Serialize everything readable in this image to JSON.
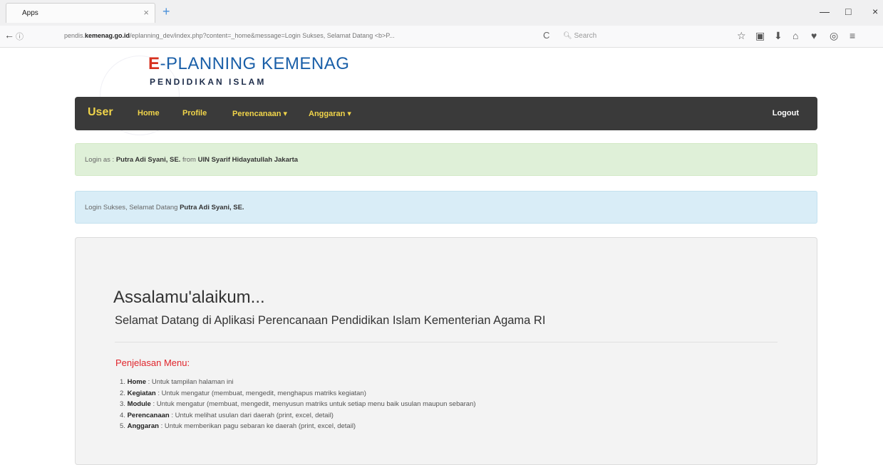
{
  "browser": {
    "tab_title": "Apps",
    "tab_close": "×",
    "new_tab": "+",
    "back": "←",
    "info": "ⓘ",
    "url_prefix": "pendis.",
    "url_domain": "kemenag.go.id",
    "url_rest": "/eplanning_dev/index.php?content=_home&message=Login Sukses, Selamat Datang <b>P...",
    "reload": "C",
    "search_placeholder": "Search",
    "toolbar_icons": [
      "star-icon",
      "clipboard-icon",
      "download-icon",
      "home-icon",
      "pocket-icon",
      "globe-icon",
      "menu-icon"
    ]
  },
  "window_controls": {
    "minimize": "—",
    "maximize": "□",
    "close": "×"
  },
  "header": {
    "title_e": "E",
    "title_rest": "-PLANNING KEMENAG",
    "subtitle": "PENDIDIKAN ISLAM"
  },
  "nav": {
    "brand": "User",
    "items": [
      "Home",
      "Profile",
      "Perencanaan ▾",
      "Anggaran ▾"
    ],
    "logout": "Logout"
  },
  "alerts": {
    "login": {
      "prefix": "Login as :",
      "name": "Putra Adi Syani, SE.",
      "from": "from",
      "institution": "UIN Syarif Hidayatullah Jakarta"
    },
    "success": {
      "text": "Login Sukses, Selamat Datang",
      "name": "Putra Adi Syani, SE."
    }
  },
  "welcome": {
    "greeting": "Assalamu'alaikum...",
    "lead": "Selamat Datang di Aplikasi Perencanaan Pendidikan Islam Kementerian Agama RI",
    "menu_title": "Penjelasan Menu:",
    "menu_items": [
      {
        "num": "1.",
        "name": "Home",
        "desc": ": Untuk tampilan halaman ini"
      },
      {
        "num": "2.",
        "name": "Kegiatan",
        "desc": ": Untuk mengatur (membuat, mengedit, menghapus matriks kegiatan)"
      },
      {
        "num": "3.",
        "name": "Module",
        "desc": ": Untuk mengatur (membuat, mengedit, menyusun matriks untuk setiap menu baik usulan maupun sebaran)"
      },
      {
        "num": "4.",
        "name": "Perencanaan",
        "desc": ": Untuk melihat usulan dari daerah (print, excel, detail)"
      },
      {
        "num": "5.",
        "name": "Anggaran",
        "desc": ": Untuk memberikan pagu sebaran ke daerah (print, excel, detail)"
      }
    ]
  }
}
